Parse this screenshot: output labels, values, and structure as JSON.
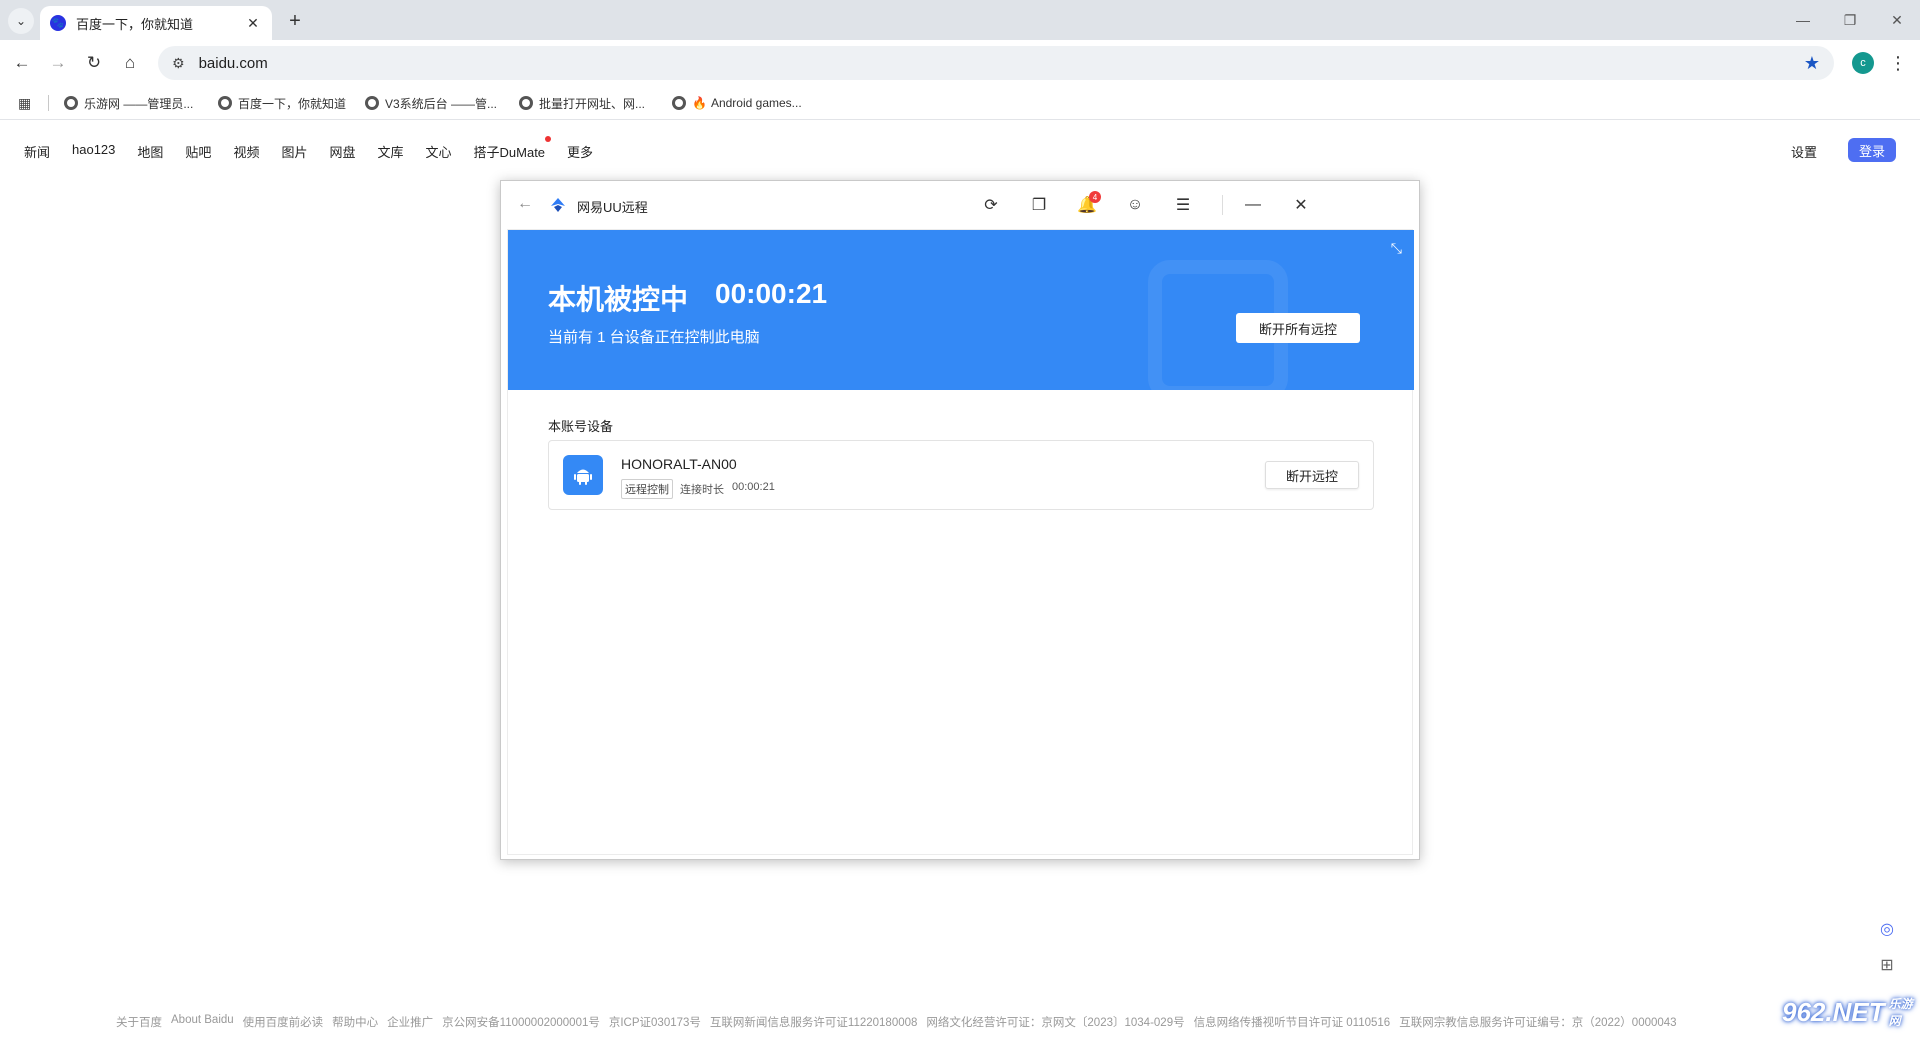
{
  "browser": {
    "tab_title": "百度一下，你就知道",
    "tab_dropdown_icon": "chevron-down-icon",
    "new_tab": "+",
    "url": "baidu.com",
    "profile_initial": "c",
    "bookmarks": [
      "乐游网 ——管理员...",
      "百度一下，你就知道",
      "V3系统后台 ——管...",
      "批量打开网址、网...",
      "Android games..."
    ]
  },
  "baidu": {
    "nav": [
      "新闻",
      "hao123",
      "地图",
      "贴吧",
      "视频",
      "图片",
      "网盘",
      "文库",
      "文心",
      "搭子DuMate",
      "更多"
    ],
    "settings": "设置",
    "login": "登录",
    "footer": [
      "关于百度",
      "About Baidu",
      "使用百度前必读",
      "帮助中心",
      "企业推广",
      "京公网安备11000002000001号",
      "京ICP证030173号",
      "互联网新闻信息服务许可证11220180008",
      "网络文化经营许可证：京网文〔2023〕1034-029号",
      "信息网络传播视听节目许可证 0110516",
      "互联网宗教信息服务许可证编号：京（2022）0000043"
    ]
  },
  "uu": {
    "app_name": "网易UU远程",
    "notification_count": "4",
    "status_title": "本机被控中",
    "timer": "00:00:21",
    "subtitle": "当前有 1 台设备正在控制此电脑",
    "disconnect_all": "断开所有远控",
    "section_title": "本账号设备",
    "device": {
      "name": "HONORALT-AN00",
      "tag": "远程控制",
      "duration_label": "连接时长",
      "duration": "00:00:21",
      "disconnect": "断开远控"
    }
  },
  "watermark": {
    "main": "962.NET",
    "sub": "乐游网"
  },
  "colors": {
    "banner_blue": "#3489f5",
    "baidu_login": "#4e6ef2",
    "badge_red": "#f03b3b"
  }
}
